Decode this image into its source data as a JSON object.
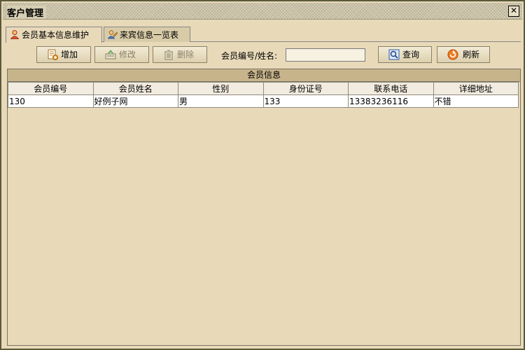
{
  "window": {
    "title": "客户管理",
    "close_symbol": "✕"
  },
  "tabs": [
    {
      "label": "会员基本信息维护",
      "icon": "user-icon",
      "active": true
    },
    {
      "label": "来宾信息一览表",
      "icon": "users-icon",
      "active": false
    }
  ],
  "toolbar": {
    "add_label": "增加",
    "edit_label": "修改",
    "delete_label": "删除",
    "search_label": "会员编号/姓名:",
    "search_value": "",
    "query_label": "查询",
    "refresh_label": "刷新"
  },
  "grid": {
    "caption": "会员信息",
    "columns": [
      "会员编号",
      "会员姓名",
      "性别",
      "身份证号",
      "联系电话",
      "详细地址"
    ],
    "rows": [
      [
        "130",
        "好例子网",
        "男",
        "133",
        "13383236116",
        "不错"
      ]
    ]
  },
  "colors": {
    "background": "#e8d9b9",
    "caption": "#c7b48b",
    "header": "#f2ece0"
  }
}
